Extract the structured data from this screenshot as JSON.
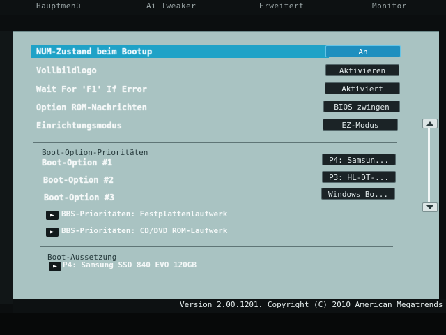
{
  "tabs": [
    "Hauptmenü",
    "Ai Tweaker",
    "Erweitert",
    "Monitor"
  ],
  "settings": [
    {
      "label": "NUM-Zustand beim Bootup",
      "value": "An"
    },
    {
      "label": "Vollbildlogo",
      "value": "Aktivieren"
    },
    {
      "label": "Wait For 'F1' If Error",
      "value": "Aktiviert"
    },
    {
      "label": "Option ROM-Nachrichten",
      "value": "BIOS zwingen"
    },
    {
      "label": "Einrichtungsmodus",
      "value": "EZ-Modus"
    }
  ],
  "boot_priorities": {
    "heading": "Boot-Option-Prioritäten",
    "options": [
      {
        "label": "Boot-Option #1",
        "value": "P4: Samsun..."
      },
      {
        "label": "Boot-Option #2",
        "value": "P3: HL-DT-..."
      },
      {
        "label": "Boot-Option #3",
        "value": "Windows Bo..."
      }
    ],
    "submenus": [
      "BBS-Prioritäten: Festplattenlaufwerk",
      "BBS-Prioritäten: CD/DVD ROM-Laufwerk"
    ]
  },
  "boot_override": {
    "heading": "Boot-Aussetzung",
    "item": "P4: Samsung SSD 840 EVO 120GB"
  },
  "footer": "Version 2.00.1201. Copyright (C) 2010 American Megatrends"
}
